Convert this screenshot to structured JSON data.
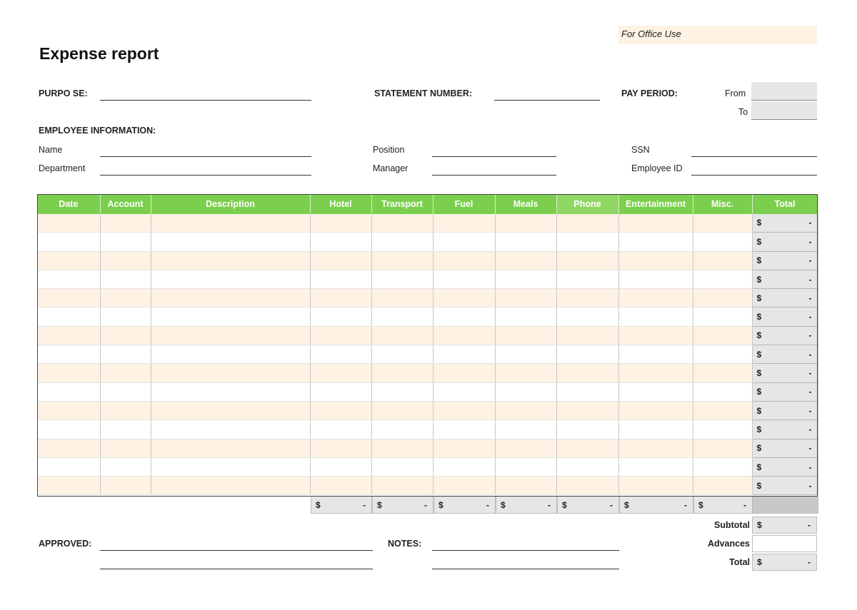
{
  "office_use": "For Office Use",
  "title": "Expense report",
  "fields": {
    "purpose": "PURPO SE:",
    "statement_number": "STATEMENT NUMBER:",
    "pay_period": "PAY PERIOD:",
    "from": "From",
    "to": "To",
    "employee_information": "EMPLOYEE INFORMATION:",
    "name": "Name",
    "department": "Department",
    "position": "Position",
    "manager": "Manager",
    "ssn": "SSN",
    "employee_id": "Employee ID"
  },
  "table": {
    "columns": [
      "Date",
      "Account",
      "Description",
      "Hotel",
      "Transport",
      "Fuel",
      "Meals",
      "Phone",
      "Entertainment",
      "Misc.",
      "Total"
    ],
    "row_count": 15,
    "currency": "$",
    "empty_value": "-"
  },
  "summary": {
    "subtotal": "Subtotal",
    "advances": "Advances",
    "total": "Total"
  },
  "footer": {
    "approved": "APPROVED:",
    "notes": "NOTES:"
  }
}
